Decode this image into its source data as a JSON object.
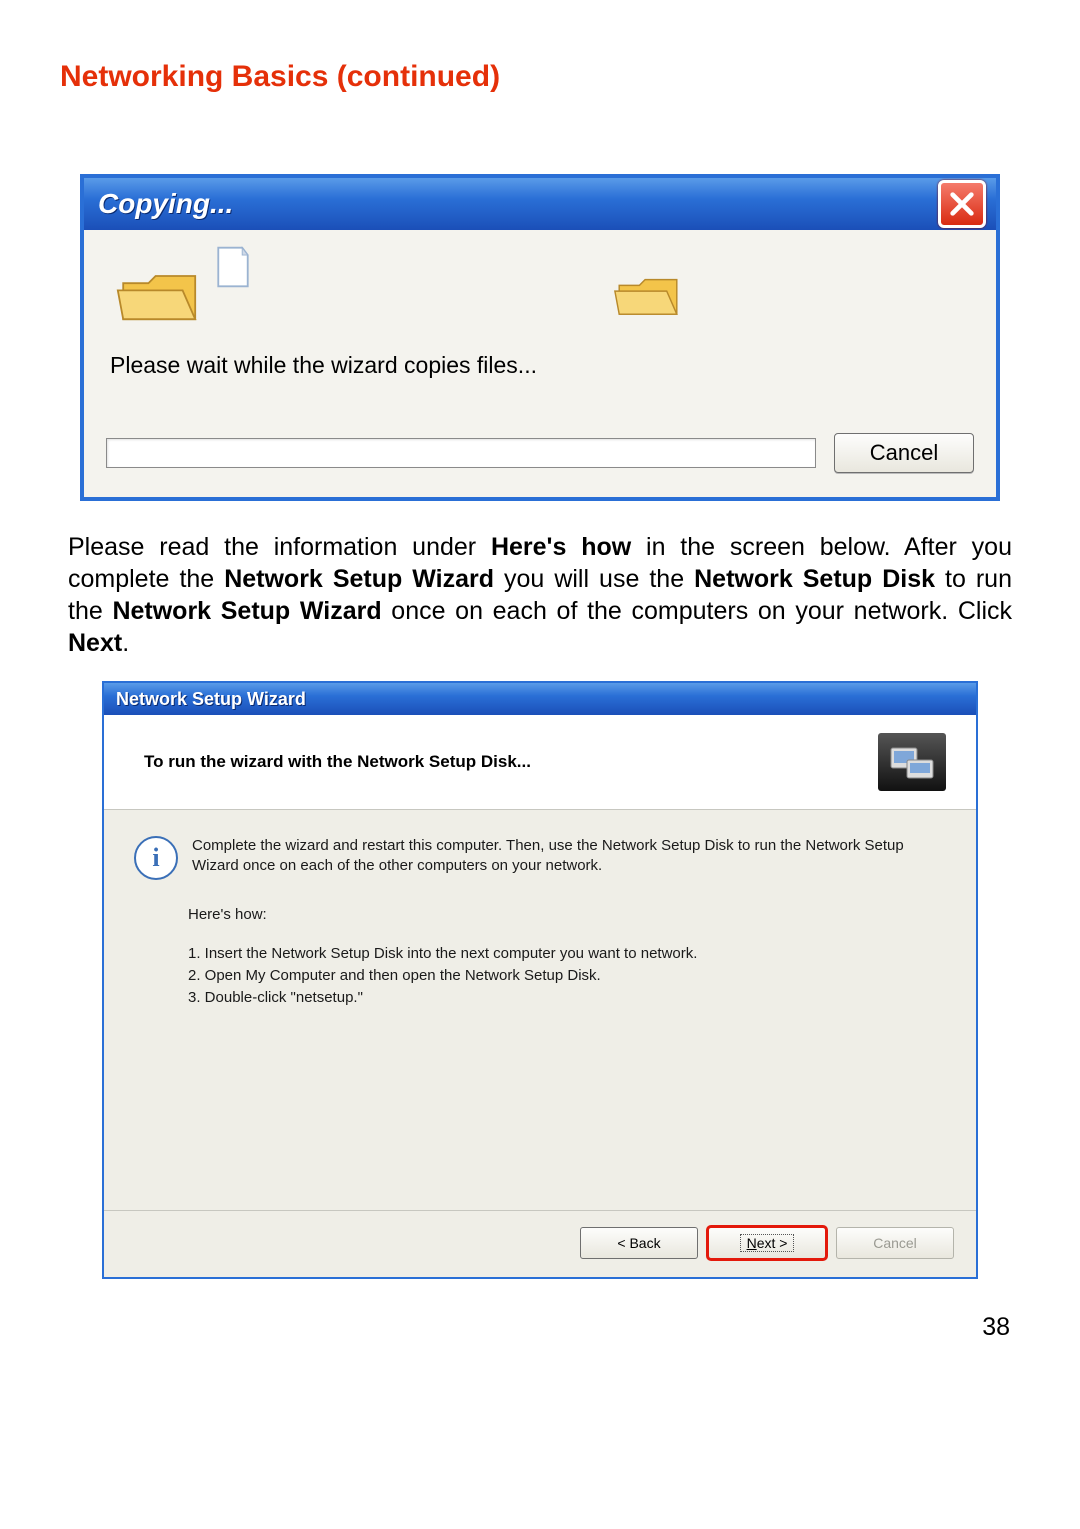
{
  "heading": "Networking Basics (continued)",
  "copy_dialog": {
    "title": "Copying...",
    "message": "Please wait while the wizard copies files...",
    "cancel_label": "Cancel"
  },
  "paragraph": {
    "p1a": "Please read the information under ",
    "p1b": "Here's how",
    "p1c": " in the screen below.  After you complete the ",
    "p1d": "Network Setup Wizard",
    "p1e": " you will use the ",
    "p1f": "Network Setup Disk",
    "p1g": " to run the ",
    "p1h": "Network Setup Wizard",
    "p1i": " once on each of the computers on your network.  Click ",
    "p1j": "Next",
    "p1k": "."
  },
  "wizard": {
    "title": "Network Setup Wizard",
    "header": "To run the wizard with the Network Setup Disk...",
    "info": "Complete the wizard and restart this computer. Then, use the Network Setup Disk to run the Network Setup Wizard once on each of the other computers on your network.",
    "heres_how": "Here's how:",
    "step1": "1.  Insert the Network Setup Disk into the next computer you want to network.",
    "step2": "2.  Open My Computer and then open the Network Setup Disk.",
    "step3": "3.  Double-click \"netsetup.\"",
    "back_label": "< Back",
    "next_prefix": "N",
    "next_suffix": "ext >",
    "cancel_label": "Cancel"
  },
  "page_number": "38"
}
